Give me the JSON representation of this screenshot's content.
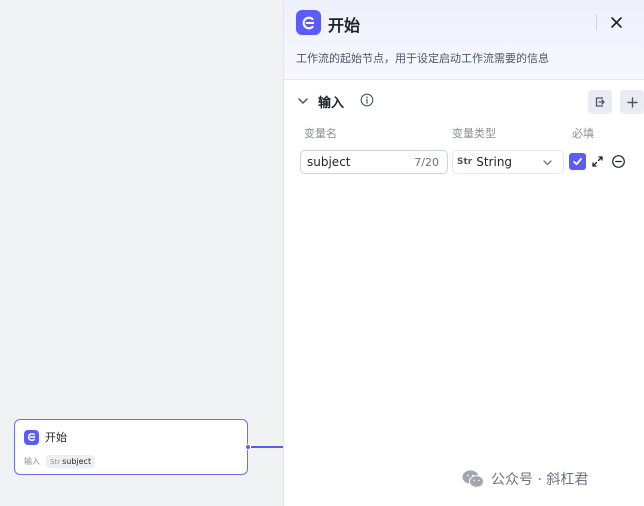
{
  "canvas": {
    "node": {
      "title": "开始",
      "io_label": "输入",
      "param_type": "Str",
      "param_name": "subject",
      "icon": "start-icon"
    }
  },
  "panel": {
    "title": "开始",
    "description": "工作流的起始节点，用于设定启动工作流需要的信息",
    "section": {
      "title": "输入",
      "columns": {
        "name": "变量名",
        "type": "变量类型",
        "required": "必填"
      },
      "variables": [
        {
          "name": "subject",
          "count": "7/20",
          "type_icon": "Str",
          "type": "String",
          "required": true
        }
      ]
    }
  },
  "watermark": {
    "text": "公众号 · 斜杠君"
  },
  "colors": {
    "accent": "#5b5cf6",
    "border": "#e5e6eb",
    "muted": "#8a8f99"
  }
}
